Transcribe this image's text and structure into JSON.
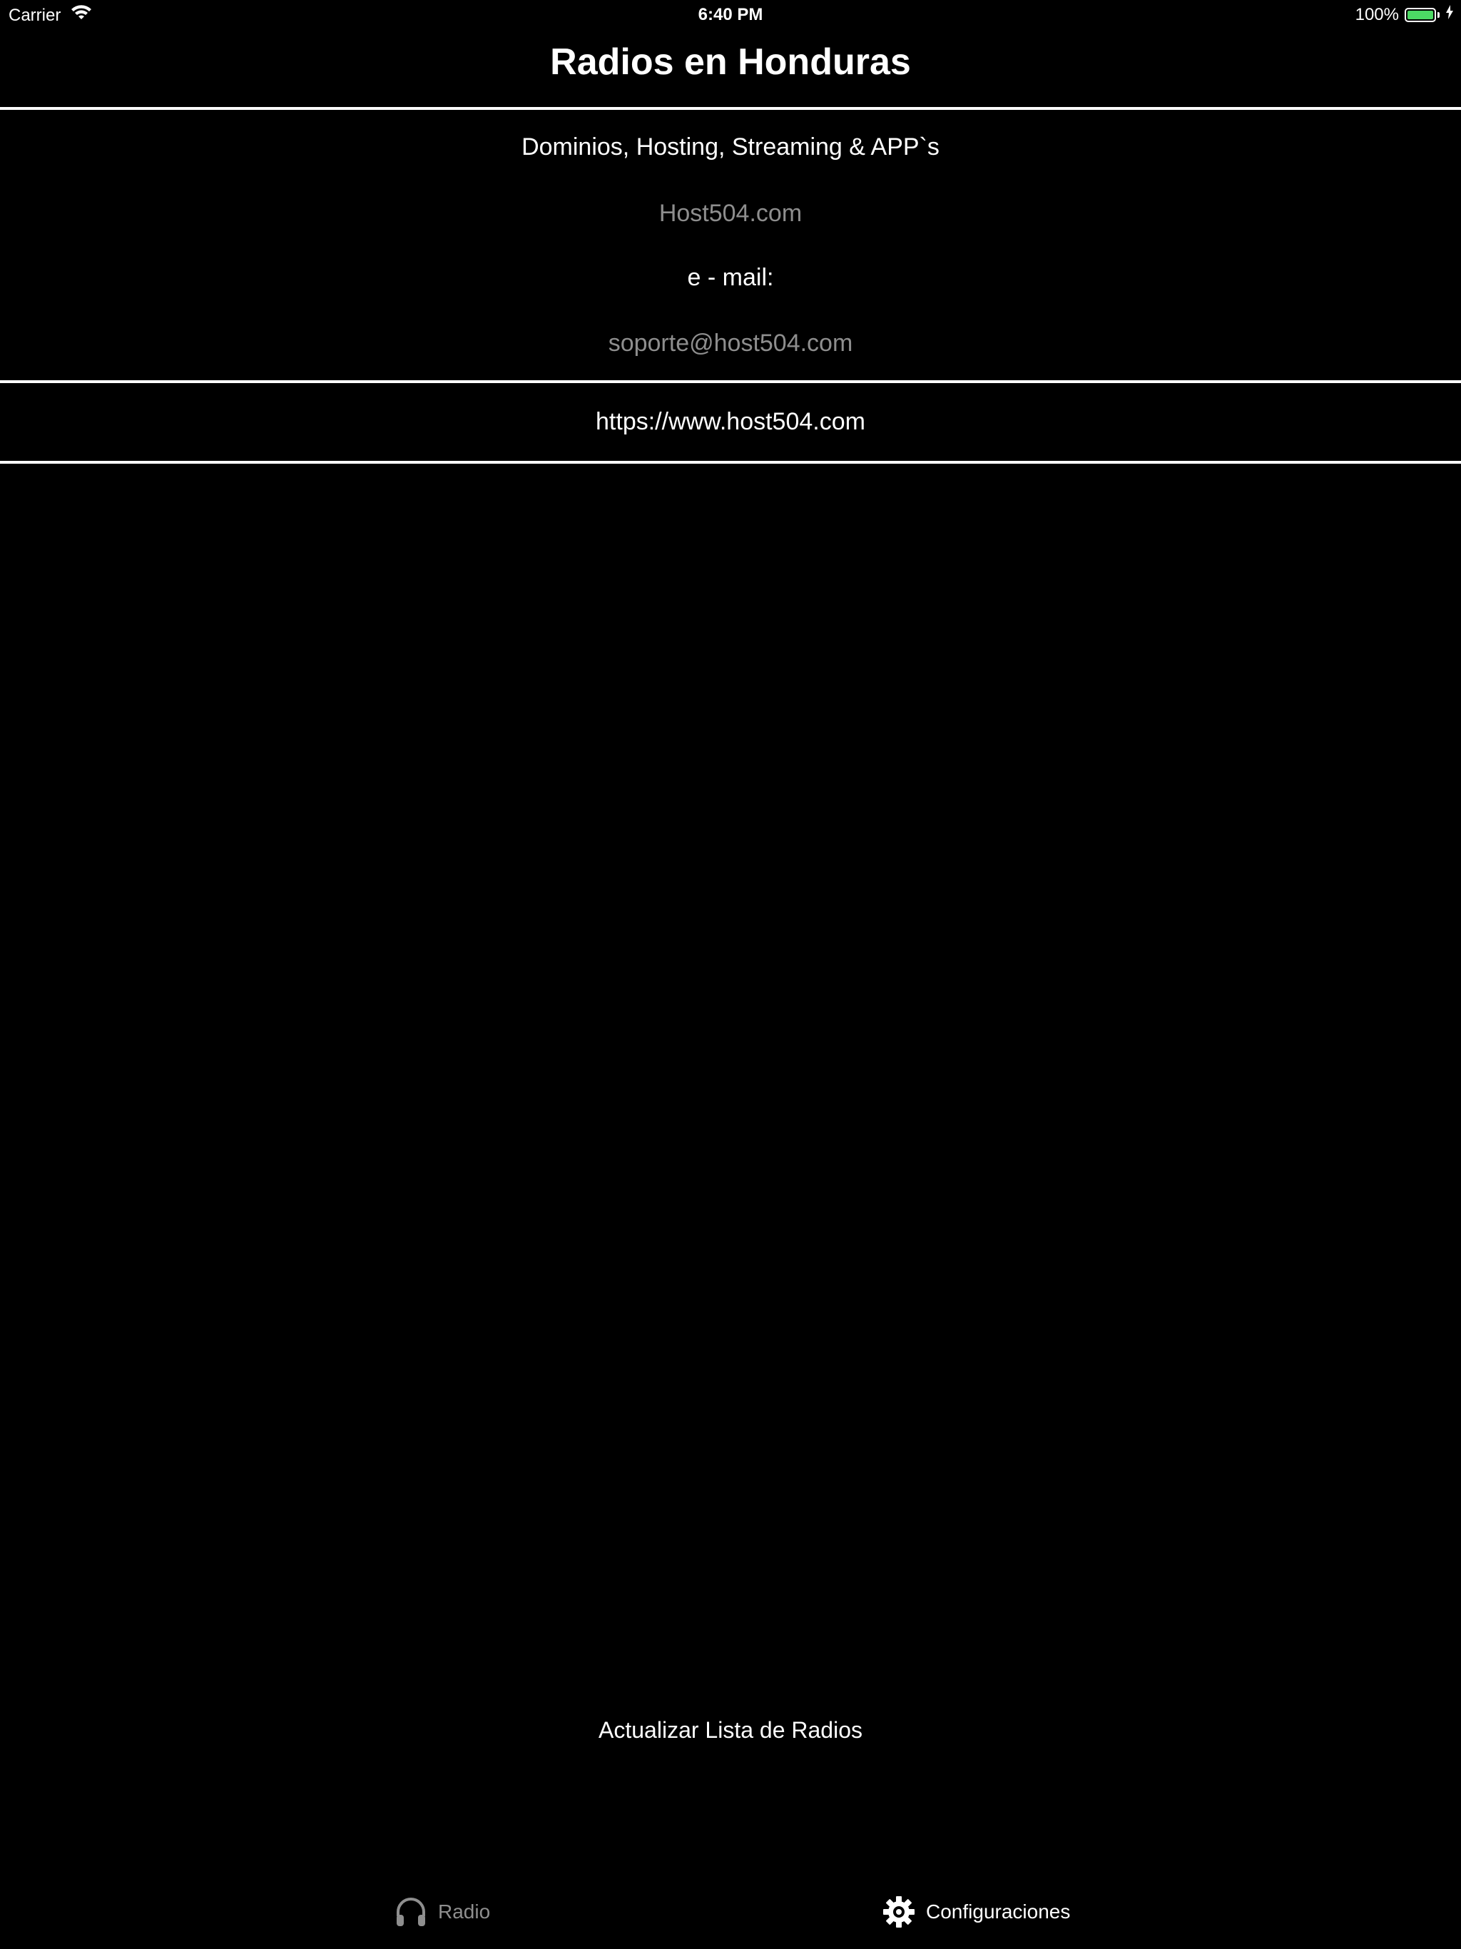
{
  "status_bar": {
    "carrier": "Carrier",
    "time": "6:40 PM",
    "battery_percent": "100%",
    "battery_level": 1.0
  },
  "header": {
    "title": "Radios en Honduras"
  },
  "info": {
    "services": "Dominios, Hosting, Streaming & APP`s",
    "company": "Host504.com",
    "email_label": "e - mail:",
    "email": "soporte@host504.com",
    "website": "https://www.host504.com"
  },
  "actions": {
    "refresh_label": "Actualizar Lista de Radios"
  },
  "tab_bar": {
    "tabs": [
      {
        "label": "Radio",
        "icon": "headphones-icon",
        "selected": false
      },
      {
        "label": "Configuraciones",
        "icon": "gear-icon",
        "selected": true
      }
    ]
  },
  "colors": {
    "background": "#000000",
    "text": "#ffffff",
    "muted_text": "#8e8e8e",
    "battery": "#4cd964"
  }
}
